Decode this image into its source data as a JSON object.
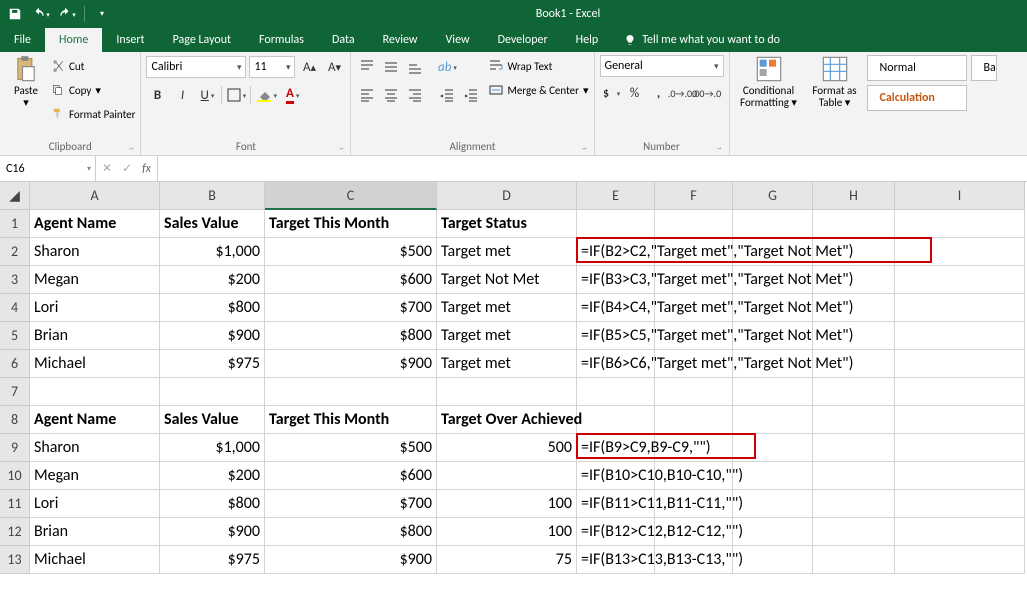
{
  "app": {
    "title": "Book1 - Excel"
  },
  "qat": {
    "save": "save-icon",
    "undo": "undo-icon",
    "redo": "redo-icon"
  },
  "tabs": {
    "file": "File",
    "home": "Home",
    "insert": "Insert",
    "pagelayout": "Page Layout",
    "formulas": "Formulas",
    "data": "Data",
    "review": "Review",
    "view": "View",
    "developer": "Developer",
    "help": "Help",
    "tellme": "Tell me what you want to do"
  },
  "ribbon": {
    "clipboard": {
      "label": "Clipboard",
      "paste": "Paste",
      "cut": "Cut",
      "copy": "Copy",
      "fp": "Format Painter"
    },
    "font": {
      "label": "Font",
      "name": "Calibri",
      "size": "11"
    },
    "alignment": {
      "label": "Alignment",
      "wrap": "Wrap Text",
      "merge": "Merge & Center"
    },
    "number": {
      "label": "Number",
      "format": "General"
    },
    "styles": {
      "cf": "Conditional Formatting",
      "fat": "Format as Table",
      "s1": "Normal",
      "s2": "Calculation",
      "s3": "Ba"
    }
  },
  "namebox": "C16",
  "cols": [
    "A",
    "B",
    "C",
    "D",
    "E",
    "F",
    "G",
    "H",
    "I"
  ],
  "rows": [
    "1",
    "2",
    "3",
    "4",
    "5",
    "6",
    "7",
    "8",
    "9",
    "10",
    "11",
    "12",
    "13"
  ],
  "table1": {
    "h": {
      "a": "Agent Name",
      "b": "Sales Value",
      "c": "Target This Month",
      "d": "Target Status"
    },
    "r": [
      {
        "a": "Sharon",
        "b": "$1,000",
        "c": "$500",
        "d": "Target met",
        "e": "=IF(B2>C2,\"Target met\",\"Target Not Met\")"
      },
      {
        "a": "Megan",
        "b": "$200",
        "c": "$600",
        "d": "Target Not Met",
        "e": "=IF(B3>C3,\"Target met\",\"Target Not Met\")"
      },
      {
        "a": "Lori",
        "b": "$800",
        "c": "$700",
        "d": "Target met",
        "e": "=IF(B4>C4,\"Target met\",\"Target Not Met\")"
      },
      {
        "a": "Brian",
        "b": "$900",
        "c": "$800",
        "d": "Target met",
        "e": "=IF(B5>C5,\"Target met\",\"Target Not Met\")"
      },
      {
        "a": "Michael",
        "b": "$975",
        "c": "$900",
        "d": "Target met",
        "e": "=IF(B6>C6,\"Target met\",\"Target Not Met\")"
      }
    ]
  },
  "table2": {
    "h": {
      "a": "Agent Name",
      "b": "Sales Value",
      "c": "Target This Month",
      "d": "Target Over Achieved"
    },
    "r": [
      {
        "a": "Sharon",
        "b": "$1,000",
        "c": "$500",
        "d": "500",
        "e": "=IF(B9>C9,B9-C9,\"\")"
      },
      {
        "a": "Megan",
        "b": "$200",
        "c": "$600",
        "d": "",
        "e": "=IF(B10>C10,B10-C10,\"\")"
      },
      {
        "a": "Lori",
        "b": "$800",
        "c": "$700",
        "d": "100",
        "e": "=IF(B11>C11,B11-C11,\"\")"
      },
      {
        "a": "Brian",
        "b": "$900",
        "c": "$800",
        "d": "100",
        "e": "=IF(B12>C12,B12-C12,\"\")"
      },
      {
        "a": "Michael",
        "b": "$975",
        "c": "$900",
        "d": "75",
        "e": "=IF(B13>C13,B13-C13,\"\")"
      }
    ]
  }
}
